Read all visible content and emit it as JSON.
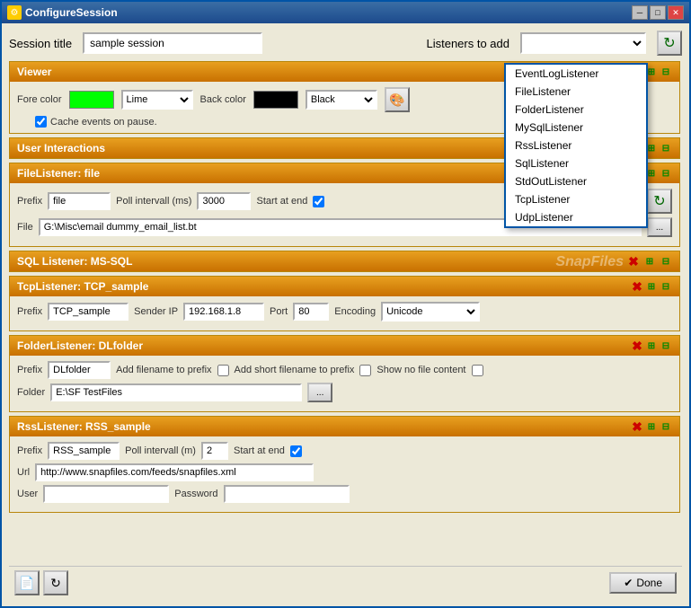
{
  "window": {
    "title": "ConfigureSession"
  },
  "header": {
    "session_title_label": "Session title",
    "session_title_value": "sample session",
    "listeners_label": "Listeners to add"
  },
  "dropdown": {
    "items": [
      "EventLogListener",
      "FileListener",
      "FolderListener",
      "MySqlListener",
      "RssListener",
      "SqlListener",
      "StdOutListener",
      "TcpListener",
      "UdpListener"
    ]
  },
  "viewer": {
    "label": "Viewer",
    "fore_color_label": "Fore color",
    "fore_color_name": "Lime",
    "back_color_label": "Back color",
    "back_color_name": "Black",
    "cache_label": "Cache events on pause."
  },
  "user_interactions": {
    "label": "User Interactions"
  },
  "file_listener": {
    "label": "FileListener: file",
    "prefix_label": "Prefix",
    "prefix_value": "file",
    "poll_label": "Poll intervall (ms)",
    "poll_value": "3000",
    "start_at_end_label": "Start at end",
    "file_label": "File",
    "file_value": "G:\\Misc\\email dummy_email_list.bt"
  },
  "sql_listener": {
    "label": "SQL Listener: MS-SQL",
    "watermark": "SnapFiles"
  },
  "tcp_listener": {
    "label": "TcpListener: TCP_sample",
    "prefix_label": "Prefix",
    "prefix_value": "TCP_sample",
    "sender_ip_label": "Sender IP",
    "sender_ip_value": "192.168.1.8",
    "port_label": "Port",
    "port_value": "80",
    "encoding_label": "Encoding",
    "encoding_value": "Unicode"
  },
  "folder_listener": {
    "label": "FolderListener: DLfolder",
    "prefix_label": "Prefix",
    "prefix_value": "DLfolder",
    "add_filename_label": "Add filename to prefix",
    "add_short_label": "Add short filename to prefix",
    "show_no_file_label": "Show no file content",
    "folder_label": "Folder",
    "folder_value": "E:\\SF TestFiles"
  },
  "rss_listener": {
    "label": "RssListener: RSS_sample",
    "prefix_label": "Prefix",
    "prefix_value": "RSS_sample",
    "poll_label": "Poll intervall (m)",
    "poll_value": "2",
    "start_at_end_label": "Start at end",
    "url_label": "Url",
    "url_value": "http://www.snapfiles.com/feeds/snapfiles.xml",
    "user_label": "User",
    "user_value": "",
    "password_label": "Password",
    "password_value": ""
  },
  "bottom": {
    "done_label": "Done"
  }
}
